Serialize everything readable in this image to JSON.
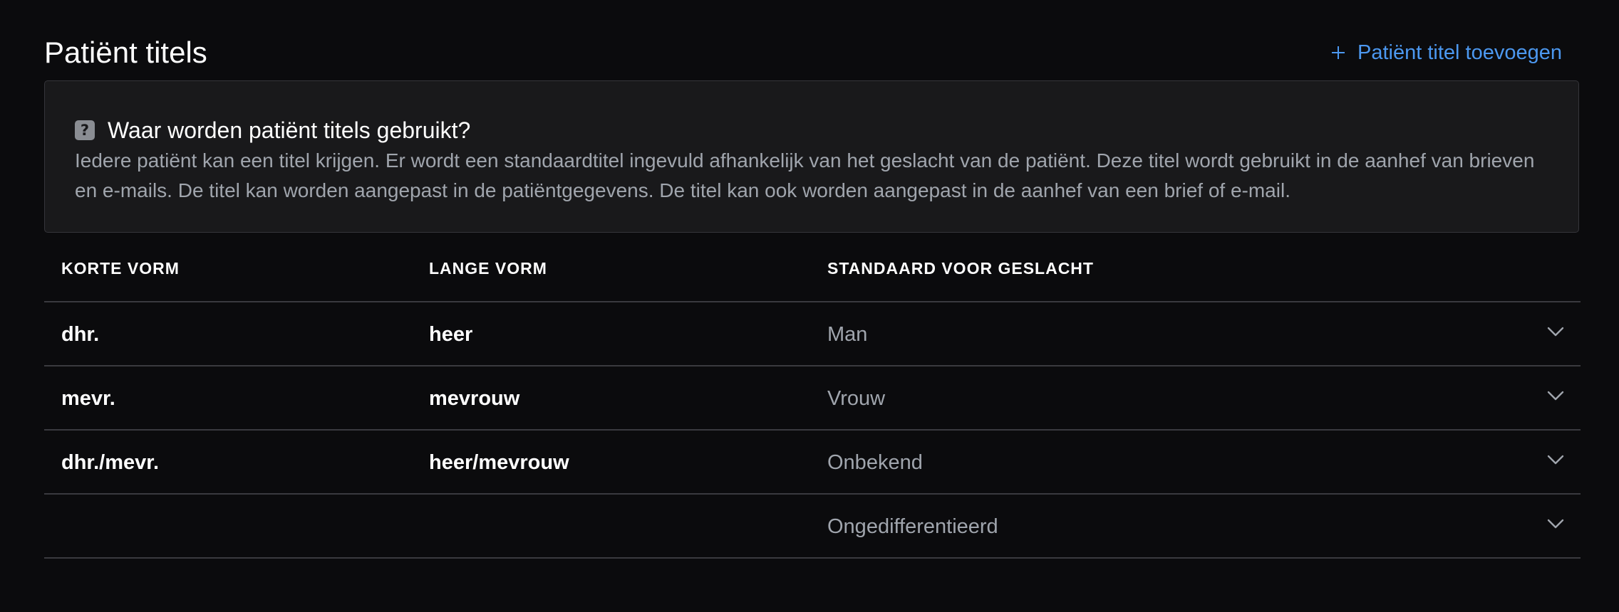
{
  "header": {
    "title": "Patiënt titels",
    "add_button_label": "Patiënt titel toevoegen",
    "add_icon": "plus-icon"
  },
  "info": {
    "icon": "question-icon",
    "title": "Waar worden patiënt titels gebruikt?",
    "text": "Iedere patiënt kan een titel krijgen. Er wordt een standaardtitel ingevuld afhankelijk van het geslacht van de patiënt. Deze titel wordt gebruikt in de aanhef van brieven en e-mails. De titel kan worden aangepast in de patiëntgegevens. De titel kan ook worden aangepast in de aanhef van een brief of e-mail."
  },
  "table": {
    "columns": {
      "short": "KORTE VORM",
      "long": "LANGE VORM",
      "gender": "STANDAARD VOOR GESLACHT"
    },
    "rows": [
      {
        "short": "dhr.",
        "long": "heer",
        "gender": "Man"
      },
      {
        "short": "mevr.",
        "long": "mevrouw",
        "gender": "Vrouw"
      },
      {
        "short": "dhr./mevr.",
        "long": "heer/mevrouw",
        "gender": "Onbekend"
      },
      {
        "short": "",
        "long": "",
        "gender": "Ongedifferentieerd"
      }
    ],
    "row_icon": "chevron-down-icon"
  },
  "colors": {
    "background": "#0b0b0d",
    "panel": "#19191b",
    "accent": "#4c98f0",
    "muted_text": "#a0a5ad",
    "divider": "#3a3a3f"
  }
}
